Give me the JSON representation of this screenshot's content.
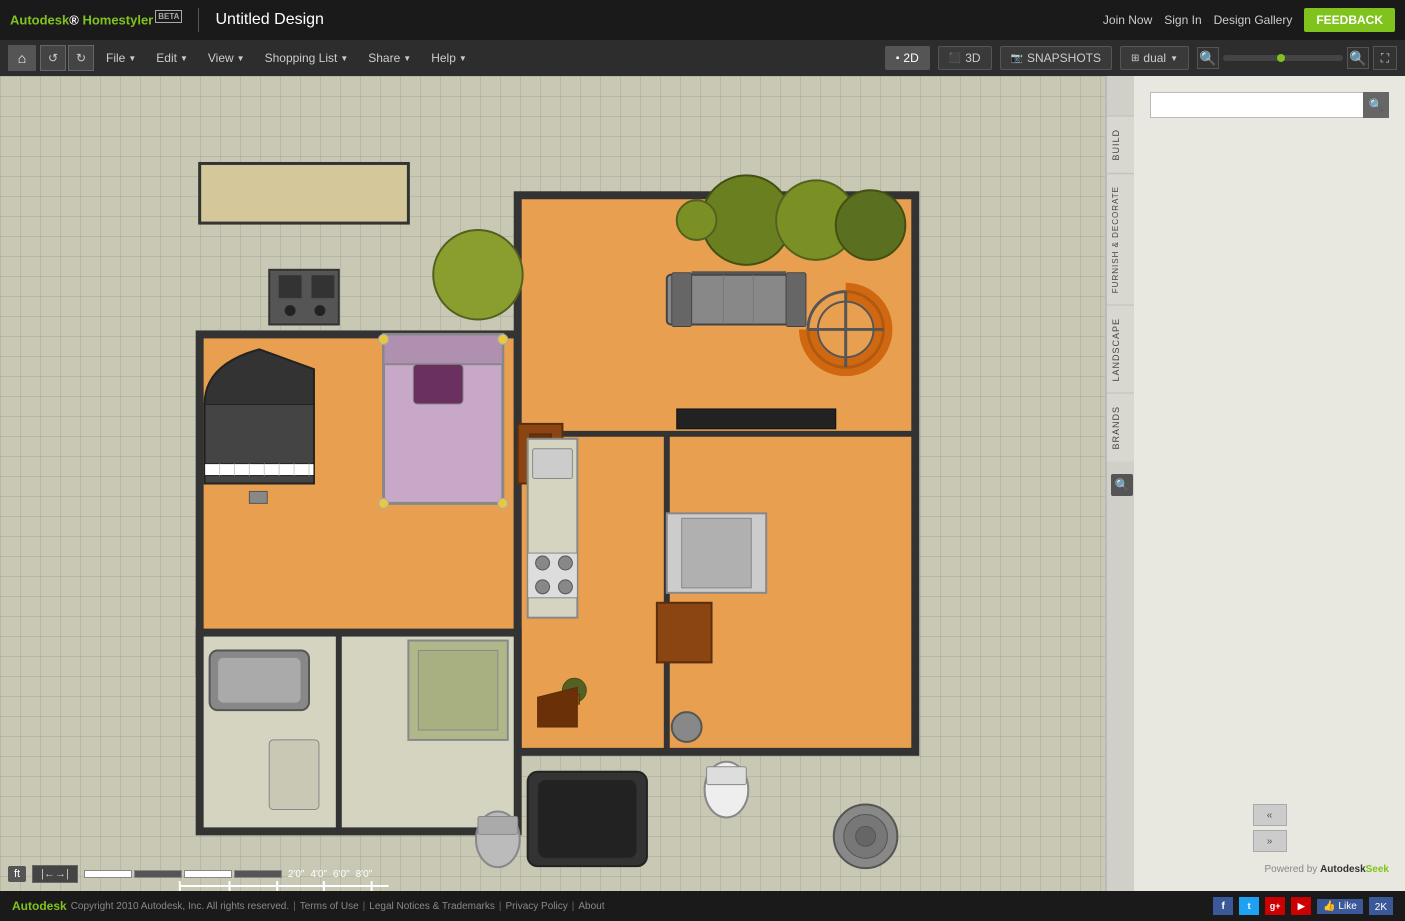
{
  "app": {
    "name": "Autodesk",
    "product": "Homestyler",
    "beta": "BETA",
    "title": "Untitled Design"
  },
  "topbar": {
    "join_now": "Join Now",
    "sign_in": "Sign In",
    "design_gallery": "Design Gallery",
    "feedback": "FEEDBACK"
  },
  "menubar": {
    "file": "File",
    "edit": "Edit",
    "view": "View",
    "shopping_list": "Shopping List",
    "share": "Share",
    "help": "Help",
    "view_2d": "2D",
    "view_3d": "3D",
    "snapshots": "SNAPSHOTS",
    "dual": "dual"
  },
  "sidepanel": {
    "build": "BUILD",
    "furnish_decorate": "FURNISH & DECORATE",
    "landscape": "LANDSCAPE",
    "brands": "BRANDS",
    "search_placeholder": ""
  },
  "bottombar": {
    "unit": "ft",
    "scale_marks": [
      "2'0\"",
      "4'0\"",
      "6'0\"",
      "8'0\""
    ],
    "powered_by": "Powered by",
    "autodesk": "Autodesk",
    "seek": "Seek"
  },
  "footer": {
    "autodesk": "Autodesk",
    "copyright": "Copyright 2010 Autodesk, Inc. All rights reserved.",
    "terms": "Terms of Use",
    "legal": "Legal Notices & Trademarks",
    "privacy": "Privacy Policy",
    "about": "About",
    "like": "Like",
    "like_count": "2K"
  }
}
